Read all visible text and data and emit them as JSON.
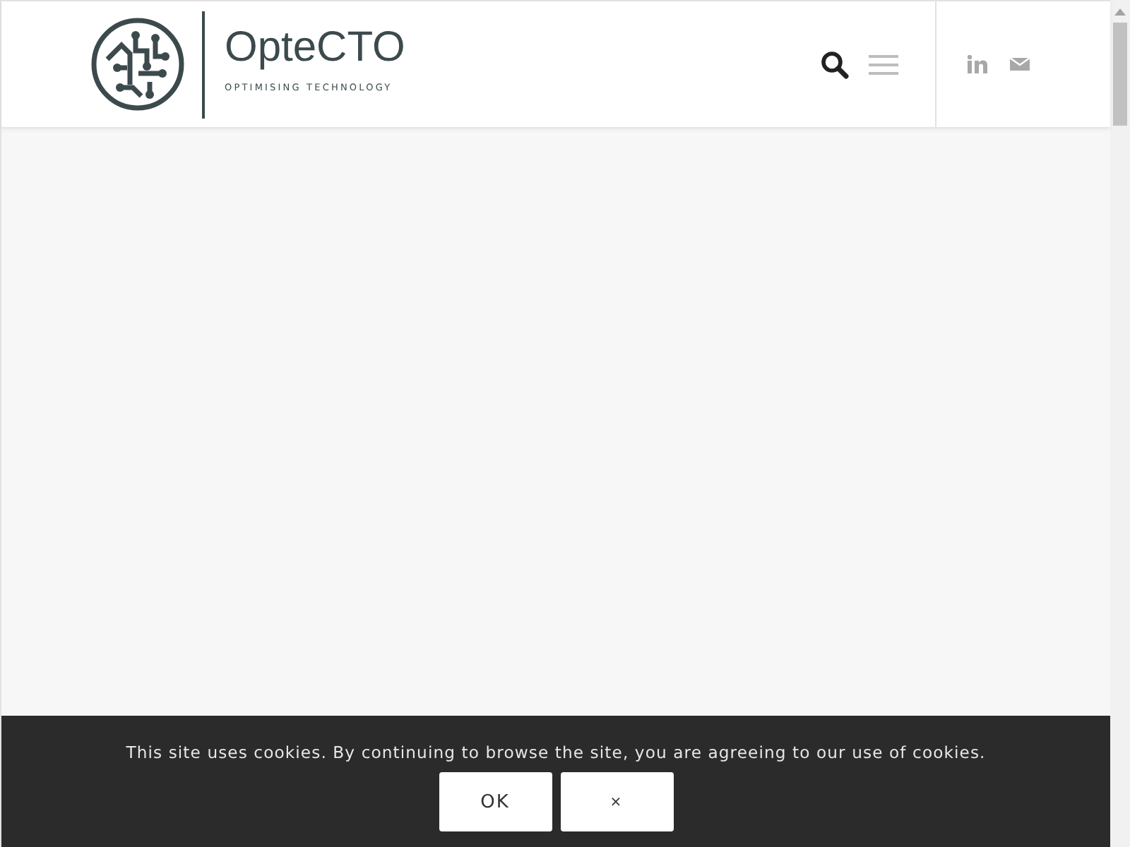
{
  "header": {
    "brand": "OpteCTO",
    "tagline": "OPTIMISING TECHNOLOGY"
  },
  "cookie_bar": {
    "message": "This site uses cookies. By continuing to browse the site, you are agreeing to our use of cookies.",
    "buttons": [
      "OK",
      "×"
    ]
  }
}
